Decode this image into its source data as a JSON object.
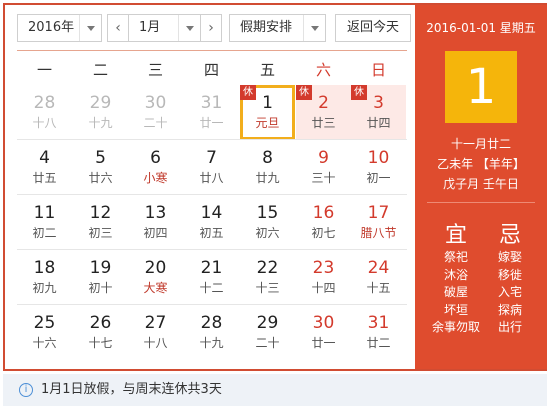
{
  "toolbar": {
    "year": "2016年",
    "prev_icon": "‹",
    "month": "1月",
    "next_icon": "›",
    "holiday": "假期安排",
    "today": "返回今天"
  },
  "weekdays": [
    "一",
    "二",
    "三",
    "四",
    "五",
    "六",
    "日"
  ],
  "weeks": [
    [
      {
        "day": "28",
        "lunar": "十八",
        "other": true
      },
      {
        "day": "29",
        "lunar": "十九",
        "other": true
      },
      {
        "day": "30",
        "lunar": "二十",
        "other": true
      },
      {
        "day": "31",
        "lunar": "廿一",
        "other": true
      },
      {
        "day": "1",
        "lunar": "元旦",
        "rest": true,
        "selected": true
      },
      {
        "day": "2",
        "lunar": "廿三",
        "rest": true
      },
      {
        "day": "3",
        "lunar": "廿四",
        "rest": true
      }
    ],
    [
      {
        "day": "4",
        "lunar": "廿五"
      },
      {
        "day": "5",
        "lunar": "廿六"
      },
      {
        "day": "6",
        "lunar": "小寒",
        "festival": true
      },
      {
        "day": "7",
        "lunar": "廿八"
      },
      {
        "day": "8",
        "lunar": "廿九"
      },
      {
        "day": "9",
        "lunar": "三十"
      },
      {
        "day": "10",
        "lunar": "初一"
      }
    ],
    [
      {
        "day": "11",
        "lunar": "初二"
      },
      {
        "day": "12",
        "lunar": "初三"
      },
      {
        "day": "13",
        "lunar": "初四"
      },
      {
        "day": "14",
        "lunar": "初五"
      },
      {
        "day": "15",
        "lunar": "初六"
      },
      {
        "day": "16",
        "lunar": "初七"
      },
      {
        "day": "17",
        "lunar": "腊八节",
        "festival": true
      }
    ],
    [
      {
        "day": "18",
        "lunar": "初九"
      },
      {
        "day": "19",
        "lunar": "初十"
      },
      {
        "day": "20",
        "lunar": "大寒",
        "festival": true
      },
      {
        "day": "21",
        "lunar": "十二"
      },
      {
        "day": "22",
        "lunar": "十三"
      },
      {
        "day": "23",
        "lunar": "十四"
      },
      {
        "day": "24",
        "lunar": "十五"
      }
    ],
    [
      {
        "day": "25",
        "lunar": "十六"
      },
      {
        "day": "26",
        "lunar": "十七"
      },
      {
        "day": "27",
        "lunar": "十八"
      },
      {
        "day": "28",
        "lunar": "十九"
      },
      {
        "day": "29",
        "lunar": "二十"
      },
      {
        "day": "30",
        "lunar": "廿一"
      },
      {
        "day": "31",
        "lunar": "廿二"
      }
    ]
  ],
  "rest_label": "休",
  "panel": {
    "date_line": "2016-01-01 星期五",
    "big_day": "1",
    "lunar_date": "十一月廿二",
    "year_ganzhi": "乙未年 【羊年】",
    "month_day_ganzhi": "戊子月 壬午日",
    "yi_title": "宜",
    "ji_title": "忌",
    "yi": [
      "祭祀",
      "沐浴",
      "破屋",
      "坏垣",
      "余事勿取"
    ],
    "ji": [
      "嫁娶",
      "移徙",
      "入宅",
      "探病",
      "出行"
    ]
  },
  "notice": {
    "icon": "info-icon",
    "text": "1月1日放假，与周末连休共3天"
  },
  "colors": {
    "accent": "#df4c2e",
    "selected_border": "#f2ae1c",
    "big_day_bg": "#f5b50b",
    "weekend": "#d33a2c",
    "rest_bg": "#fde9e6"
  }
}
